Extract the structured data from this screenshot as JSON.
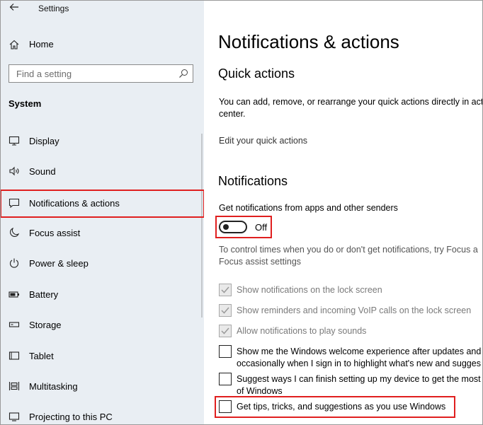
{
  "window": {
    "title": "Settings"
  },
  "sidebar": {
    "home": "Home",
    "search_placeholder": "Find a setting",
    "section": "System",
    "items": [
      {
        "label": "Display",
        "icon": "monitor-icon"
      },
      {
        "label": "Sound",
        "icon": "speaker-icon"
      },
      {
        "label": "Notifications & actions",
        "icon": "message-icon",
        "selected": true
      },
      {
        "label": "Focus assist",
        "icon": "moon-icon"
      },
      {
        "label": "Power & sleep",
        "icon": "power-icon"
      },
      {
        "label": "Battery",
        "icon": "battery-icon"
      },
      {
        "label": "Storage",
        "icon": "storage-icon"
      },
      {
        "label": "Tablet",
        "icon": "tablet-icon"
      },
      {
        "label": "Multitasking",
        "icon": "multitasking-icon"
      },
      {
        "label": "Projecting to this PC",
        "icon": "projector-icon"
      }
    ]
  },
  "main": {
    "title": "Notifications & actions",
    "quick_actions": {
      "heading": "Quick actions",
      "desc_line1": "You can add, remove, or rearrange your quick actions directly in act",
      "desc_line2": "center.",
      "link": "Edit your quick actions"
    },
    "notifications": {
      "heading": "Notifications",
      "get_label": "Get notifications from apps and other senders",
      "toggle_state": "Off",
      "focus_text": "To control times when you do or don't get notifications, try Focus a",
      "focus_link": "Focus assist settings",
      "options": [
        {
          "line1": "Show notifications on the lock screen",
          "checked": true,
          "disabled": true
        },
        {
          "line1": "Show reminders and incoming VoIP calls on the lock screen",
          "checked": true,
          "disabled": true
        },
        {
          "line1": "Allow notifications to play sounds",
          "checked": true,
          "disabled": true
        },
        {
          "line1": "Show me the Windows welcome experience after updates and",
          "line2": "occasionally when I sign in to highlight what's new and sugges",
          "checked": false,
          "disabled": false
        },
        {
          "line1": "Suggest ways I can finish setting up my device to get the most",
          "line2": "of Windows",
          "checked": false,
          "disabled": false
        },
        {
          "line1": "Get tips, tricks, and suggestions as you use Windows",
          "checked": false,
          "disabled": false
        }
      ]
    }
  },
  "colors": {
    "sidebar_bg": "#e9eef3",
    "highlight": "#e01f1f"
  }
}
